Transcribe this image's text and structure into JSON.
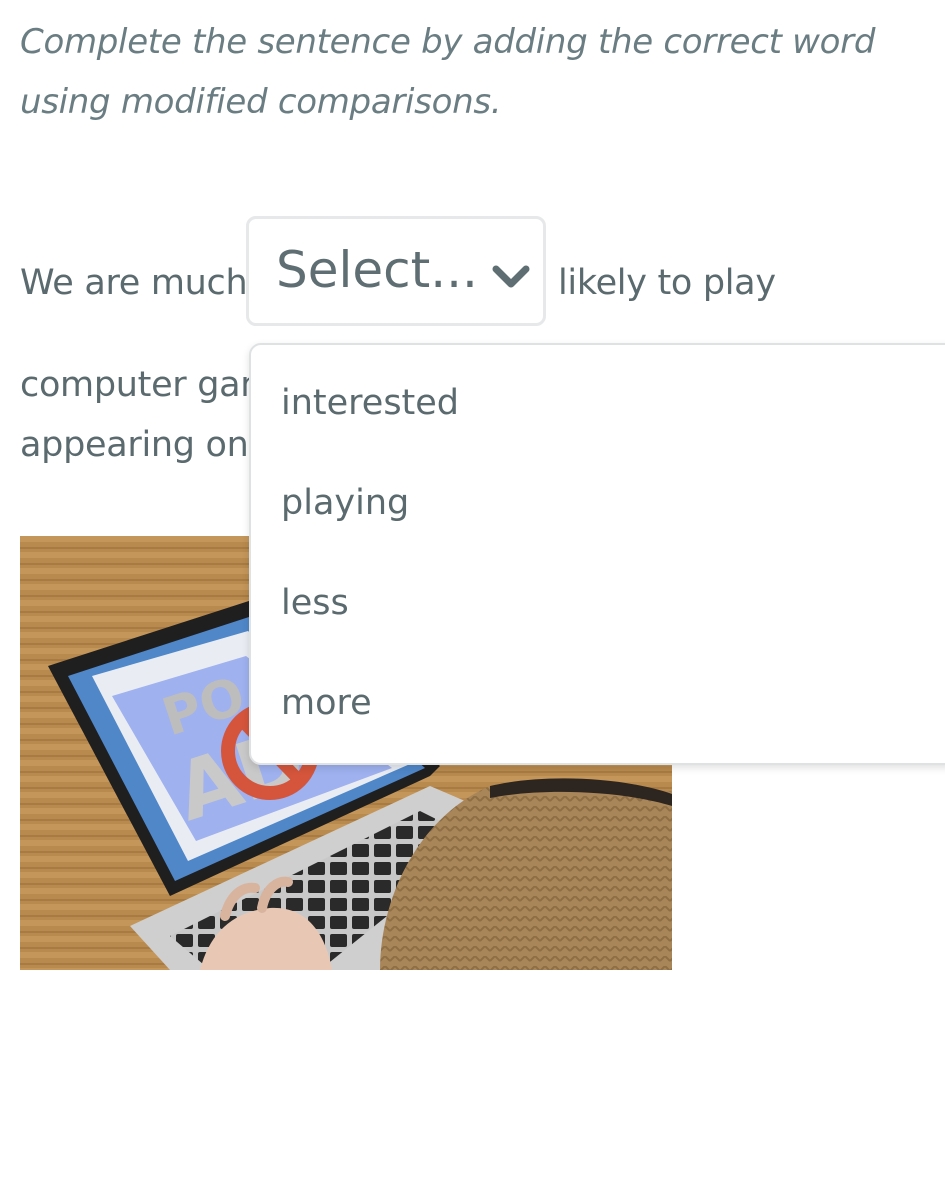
{
  "instructions": "Complete the sentence by adding the correct word using modified comparisons.",
  "sentence": {
    "before": "We are much",
    "after": "likely to play",
    "line2_visible": "computer gam",
    "line3_visible": "appearing on"
  },
  "select": {
    "placeholder": "Select...",
    "icon": "chevron-down-icon",
    "options": [
      "interested",
      "playing",
      "less",
      "more"
    ]
  },
  "image": {
    "subject": "laptop-with-pop-up-ad-blocked-icon"
  },
  "colors": {
    "text": "#5a6a6e",
    "border": "#e6e8e9"
  }
}
